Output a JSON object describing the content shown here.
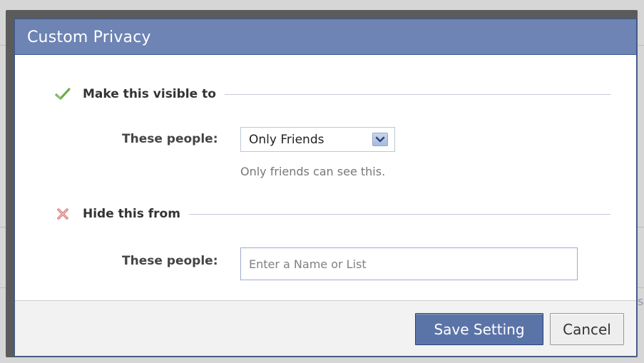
{
  "dialog": {
    "title": "Custom Privacy"
  },
  "visible_section": {
    "title": "Make this visible to",
    "icon": "checkmark-icon",
    "field_label": "These people:",
    "select_value": "Only Friends",
    "helper_text": "Only friends can see this."
  },
  "hide_section": {
    "title": "Hide this from",
    "icon": "x-mark-icon",
    "field_label": "These people:",
    "input_value": "",
    "input_placeholder": "Enter a Name or List"
  },
  "footer": {
    "save_label": "Save Setting",
    "cancel_label": "Cancel"
  },
  "background": {
    "edge_text": "s"
  },
  "colors": {
    "header_bg": "#6d84b4",
    "primary_button": "#5b74a8",
    "check_green": "#6cae4b",
    "x_red": "#e08a8a"
  }
}
